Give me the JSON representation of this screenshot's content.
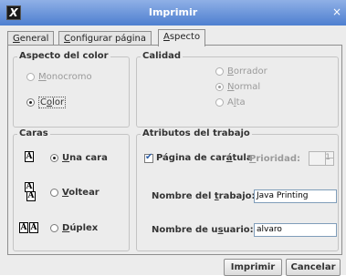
{
  "window": {
    "title": "Imprimir",
    "icon": "java-x-icon",
    "close_glyph": "×"
  },
  "tabs": [
    {
      "prefix": "",
      "mnemonic": "G",
      "rest": "eneral",
      "active": false
    },
    {
      "prefix": "",
      "mnemonic": "C",
      "rest": "onfigurar página",
      "active": false
    },
    {
      "prefix": "",
      "mnemonic": "A",
      "rest": "specto",
      "active": true
    }
  ],
  "color_group": {
    "title": "Aspecto del color",
    "options": [
      {
        "prefix": "",
        "mnemonic": "M",
        "rest": "onocromo",
        "selected": false,
        "enabled": false
      },
      {
        "prefix": "C",
        "mnemonic": "o",
        "rest": "lor",
        "selected": true,
        "enabled": true
      }
    ]
  },
  "quality_group": {
    "title": "Calidad",
    "options": [
      {
        "prefix": "",
        "mnemonic": "B",
        "rest": "orrador",
        "selected": false,
        "enabled": false
      },
      {
        "prefix": "",
        "mnemonic": "N",
        "rest": "ormal",
        "selected": true,
        "enabled": false
      },
      {
        "prefix": "A",
        "mnemonic": "l",
        "rest": "ta",
        "selected": false,
        "enabled": false
      }
    ]
  },
  "sides_group": {
    "title": "Caras",
    "options": [
      {
        "prefix": "",
        "mnemonic": "U",
        "rest": "na cara",
        "selected": true,
        "icon": "one-side-icon"
      },
      {
        "prefix": "",
        "mnemonic": "V",
        "rest": "oltear",
        "selected": false,
        "icon": "tumble-icon"
      },
      {
        "prefix": "",
        "mnemonic": "D",
        "rest": "úplex",
        "selected": false,
        "icon": "duplex-icon"
      }
    ],
    "icon_glyph": "A"
  },
  "job_group": {
    "title": "Atributos del trabajo",
    "cover_page": {
      "prefix": "Página de car",
      "mnemonic": "á",
      "rest": "tula",
      "checked": true
    },
    "priority": {
      "prefix": "",
      "mnemonic": "P",
      "rest": "rioridad:",
      "value": "1"
    },
    "job_name": {
      "prefix": "Nombre del ",
      "mnemonic": "t",
      "rest": "rabajo:",
      "value": "Java Printing"
    },
    "user_name": {
      "prefix": "Nombre de u",
      "mnemonic": "s",
      "rest": "uario:",
      "value": "alvaro"
    }
  },
  "buttons": {
    "print": "Imprimir",
    "cancel": "Cancelar"
  }
}
